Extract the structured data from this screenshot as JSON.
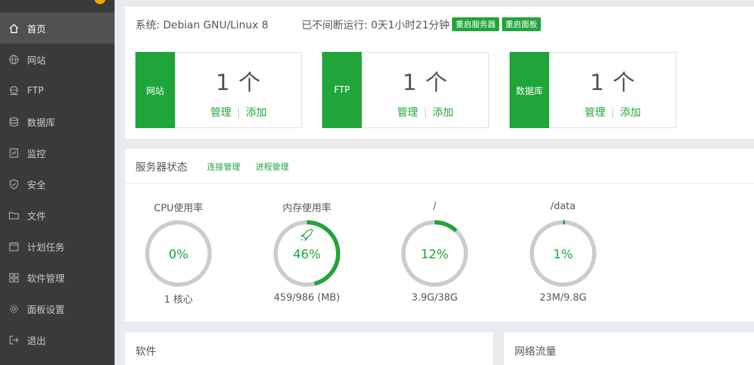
{
  "sidebar": {
    "logo": "✦",
    "items": [
      {
        "label": "首页",
        "icon": "home-icon",
        "active": true
      },
      {
        "label": "网站",
        "icon": "globe-icon",
        "active": false
      },
      {
        "label": "FTP",
        "icon": "ftp-icon",
        "active": false
      },
      {
        "label": "数据库",
        "icon": "database-icon",
        "active": false
      },
      {
        "label": "监控",
        "icon": "monitor-icon",
        "active": false
      },
      {
        "label": "安全",
        "icon": "shield-icon",
        "active": false
      },
      {
        "label": "文件",
        "icon": "folder-icon",
        "active": false
      },
      {
        "label": "计划任务",
        "icon": "calendar-icon",
        "active": false
      },
      {
        "label": "软件管理",
        "icon": "grid-icon",
        "active": false
      },
      {
        "label": "面板设置",
        "icon": "gear-icon",
        "active": false
      },
      {
        "label": "退出",
        "icon": "logout-icon",
        "active": false
      }
    ]
  },
  "system": {
    "os": "系统: Debian GNU/Linux 8",
    "uptime": "已不间断运行: 0天1小时21分钟",
    "restart_server": "重启服务器",
    "restart_panel": "重启面板"
  },
  "cards": [
    {
      "tag": "网站",
      "count": "1 个",
      "manage": "管理",
      "sep": "|",
      "add": "添加"
    },
    {
      "tag": "FTP",
      "count": "1 个",
      "manage": "管理",
      "sep": "|",
      "add": "添加"
    },
    {
      "tag": "数据库",
      "count": "1 个",
      "manage": "管理",
      "sep": "|",
      "add": "添加"
    }
  ],
  "status": {
    "title": "服务器状态",
    "conn_link": "连接管理",
    "proc_link": "进程管理",
    "gauges": [
      {
        "label": "CPU使用率",
        "value_text": "0%",
        "percent": 0,
        "footer": "1 核心",
        "rocket": false
      },
      {
        "label": "内存使用率",
        "value_text": "46%",
        "percent": 46,
        "footer": "459/986 (MB)",
        "rocket": true
      },
      {
        "label": "/",
        "value_text": "12%",
        "percent": 12,
        "footer": "3.9G/38G",
        "rocket": false
      },
      {
        "label": "/data",
        "value_text": "1%",
        "percent": 1,
        "footer": "23M/9.8G",
        "rocket": false
      }
    ]
  },
  "software": {
    "title": "软件"
  },
  "traffic": {
    "title": "网络流量"
  },
  "colors": {
    "accent": "#20a53a",
    "sidebar_bg": "#3a3a3a",
    "sidebar_active": "#505050",
    "ring_track": "#cccccc"
  }
}
